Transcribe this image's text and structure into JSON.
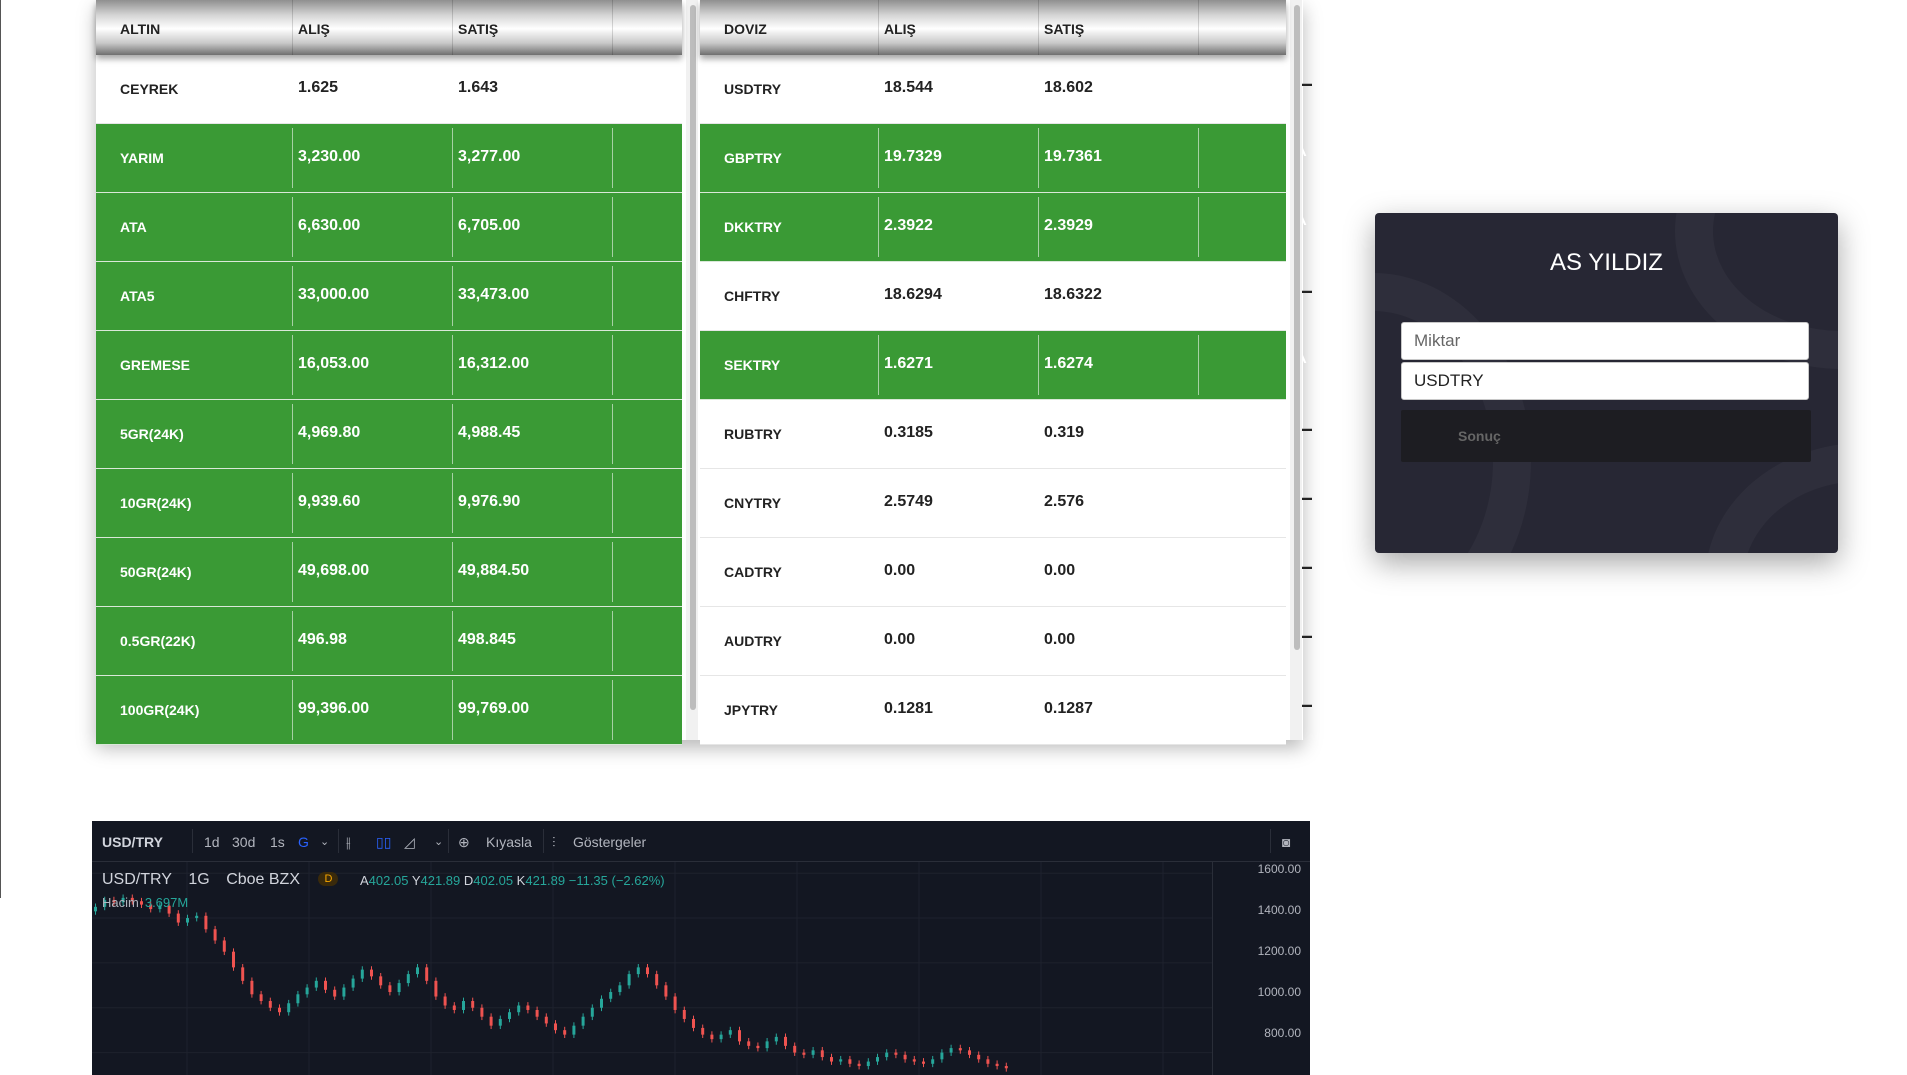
{
  "gold_table": {
    "headers": [
      "ALTIN",
      "ALIŞ",
      "SATIŞ"
    ],
    "rows": [
      {
        "name": "CEYREK",
        "buy": "1.625",
        "sell": "1.643",
        "trend": "flat"
      },
      {
        "name": "YARIM",
        "buy": "3,230.00",
        "sell": "3,277.00",
        "trend": "up"
      },
      {
        "name": "ATA",
        "buy": "6,630.00",
        "sell": "6,705.00",
        "trend": "up"
      },
      {
        "name": "ATA5",
        "buy": "33,000.00",
        "sell": "33,473.00",
        "trend": "up"
      },
      {
        "name": "GREMESE",
        "buy": "16,053.00",
        "sell": "16,312.00",
        "trend": "up"
      },
      {
        "name": "5GR(24K)",
        "buy": "4,969.80",
        "sell": "4,988.45",
        "trend": "up"
      },
      {
        "name": "10GR(24K)",
        "buy": "9,939.60",
        "sell": "9,976.90",
        "trend": "up"
      },
      {
        "name": "50GR(24K)",
        "buy": "49,698.00",
        "sell": "49,884.50",
        "trend": "up"
      },
      {
        "name": "0.5GR(22K)",
        "buy": "496.98",
        "sell": "498.845",
        "trend": "up"
      },
      {
        "name": "100GR(24K)",
        "buy": "99,396.00",
        "sell": "99,769.00",
        "trend": "up"
      }
    ]
  },
  "fx_table": {
    "headers": [
      "DOVIZ",
      "ALIŞ",
      "SATIŞ"
    ],
    "rows": [
      {
        "name": "USDTRY",
        "buy": "18.544",
        "sell": "18.602",
        "trend": "flat"
      },
      {
        "name": "GBPTRY",
        "buy": "19.7329",
        "sell": "19.7361",
        "trend": "up"
      },
      {
        "name": "DKKTRY",
        "buy": "2.3922",
        "sell": "2.3929",
        "trend": "up"
      },
      {
        "name": "CHFTRY",
        "buy": "18.6294",
        "sell": "18.6322",
        "trend": "flat"
      },
      {
        "name": "SEKTRY",
        "buy": "1.6271",
        "sell": "1.6274",
        "trend": "up"
      },
      {
        "name": "RUBTRY",
        "buy": "0.3185",
        "sell": "0.319",
        "trend": "flat"
      },
      {
        "name": "CNYTRY",
        "buy": "2.5749",
        "sell": "2.576",
        "trend": "flat"
      },
      {
        "name": "CADTRY",
        "buy": "0.00",
        "sell": "0.00",
        "trend": "flat"
      },
      {
        "name": "AUDTRY",
        "buy": "0.00",
        "sell": "0.00",
        "trend": "flat"
      },
      {
        "name": "JPYTRY",
        "buy": "0.1281",
        "sell": "0.1287",
        "trend": "flat"
      }
    ]
  },
  "trend_icons": {
    "up": "^",
    "flat": "—"
  },
  "converter": {
    "title": "AS YILDIZ",
    "amount_placeholder": "Miktar",
    "currency_value": "USDTRY",
    "result_label": "Sonuç"
  },
  "chart_widget": {
    "toolbar": {
      "symbol": "USD/TRY",
      "intervals": [
        "1d",
        "30d",
        "1s"
      ],
      "active_interval": "G",
      "compare_label": "Kıyasla",
      "indicators_label": "Göstergeler"
    },
    "legend": {
      "symbol": "USD/TRY",
      "interval": "1G",
      "exchange": "Cboe BZX",
      "badge": "D",
      "open_label": "A",
      "open": "402.05",
      "high_label": "Y",
      "high": "421.89",
      "low_label": "D",
      "low": "402.05",
      "close_label": "K",
      "close": "421.89",
      "change": "−11.35 (−2.62%)",
      "volume_label": "Hacim",
      "volume": "3.697M"
    },
    "price_scale": [
      "1600.00",
      "1400.00",
      "1200.00",
      "1000.00",
      "800.00"
    ],
    "colors": {
      "up": "#26a69a",
      "down": "#ef5350",
      "background": "#131722"
    }
  },
  "chart_data": {
    "type": "candlestick",
    "title": "USD/TRY",
    "ylim": [
      700,
      1650
    ],
    "close_series": [
      1450,
      1480,
      1470,
      1490,
      1475,
      1460,
      1440,
      1455,
      1420,
      1380,
      1400,
      1410,
      1350,
      1300,
      1250,
      1180,
      1120,
      1060,
      1030,
      1000,
      980,
      1020,
      1060,
      1090,
      1120,
      1080,
      1050,
      1090,
      1130,
      1170,
      1140,
      1100,
      1070,
      1110,
      1150,
      1180,
      1120,
      1050,
      1010,
      990,
      1030,
      1000,
      960,
      920,
      950,
      980,
      1010,
      990,
      960,
      930,
      900,
      880,
      920,
      960,
      1000,
      1040,
      1070,
      1100,
      1150,
      1180,
      1150,
      1100,
      1050,
      990,
      950,
      910,
      880,
      860,
      880,
      900,
      850,
      830,
      820,
      850,
      870,
      830,
      800,
      790,
      810,
      780,
      760,
      770,
      750,
      740,
      760,
      780,
      800,
      790,
      770,
      760,
      750,
      770,
      800,
      820,
      810,
      790,
      770,
      750,
      740,
      730
    ]
  }
}
